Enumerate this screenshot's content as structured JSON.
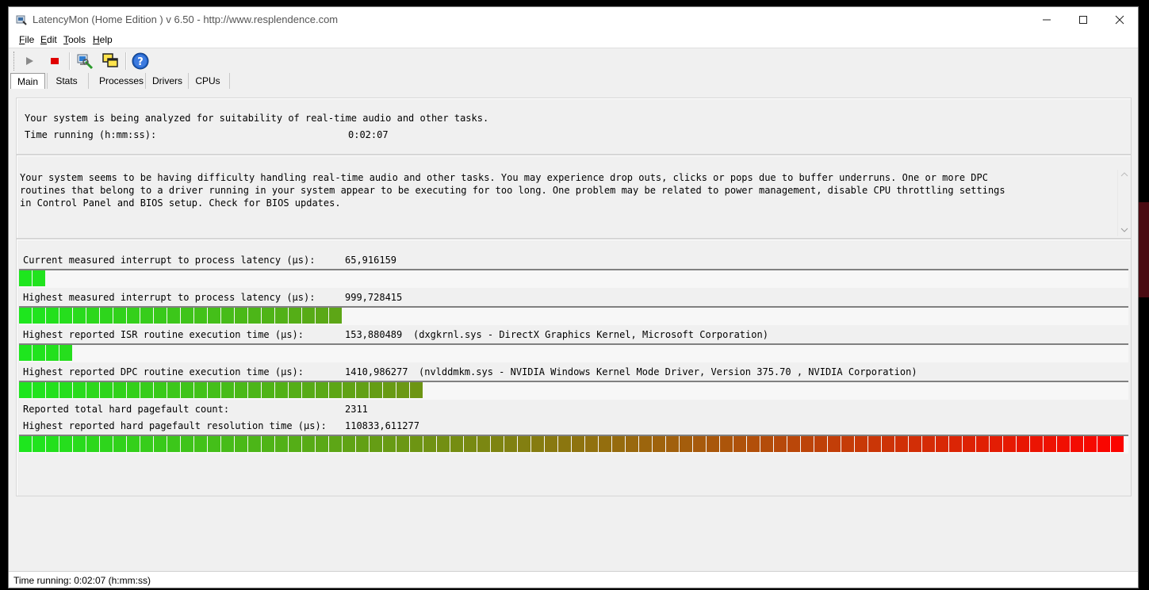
{
  "window": {
    "title": "LatencyMon  (Home Edition )  v 6.50 - http://www.resplendence.com",
    "controls": [
      "minimize-icon",
      "maximize-icon",
      "close-icon"
    ]
  },
  "menu": [
    {
      "accel": "F",
      "rest": "ile"
    },
    {
      "accel": "E",
      "rest": "dit"
    },
    {
      "accel": "T",
      "rest": "ools"
    },
    {
      "accel": "H",
      "rest": "elp"
    }
  ],
  "toolbar_icons": [
    "play-icon",
    "stop-icon",
    "analyze-icon",
    "windows-icon",
    "help-icon"
  ],
  "tabs": [
    {
      "label": "Main",
      "active": true
    },
    {
      "label": "Stats",
      "active": false
    },
    {
      "label": "Processes",
      "active": false
    },
    {
      "label": "Drivers",
      "active": false
    },
    {
      "label": "CPUs",
      "active": false
    }
  ],
  "status_panel": {
    "line1": "Your system is being analyzed for suitability of real-time audio and other tasks.",
    "time_label": "Time running (h:mm:ss):",
    "time_value": "0:02:07"
  },
  "conclusion": {
    "lines": [
      "Your system seems to be having difficulty handling real-time audio and other tasks. You may experience drop outs, clicks or pops due to buffer underruns. One or more DPC",
      "routines that belong to a driver running in your system appear to be executing for too long. One problem may be related to power management, disable CPU throttling settings",
      "in Control Panel and BIOS setup. Check for BIOS updates."
    ]
  },
  "measurements": [
    {
      "label": "Current measured interrupt to process latency (µs):",
      "value": "65,916159",
      "detail": "",
      "level": 0.023
    },
    {
      "label": "Highest measured interrupt to process latency (µs):",
      "value": "999,728415",
      "detail": "",
      "level": 0.29
    },
    {
      "label": "Highest reported ISR routine execution time (µs):",
      "value": "153,880489",
      "detail": "(dxgkrnl.sys - DirectX Graphics Kernel, Microsoft Corporation)",
      "level": 0.047
    },
    {
      "label": "Highest reported DPC routine execution time (µs):",
      "value": "1410,986277",
      "detail": "(nvlddmkm.sys - NVIDIA Windows Kernel Mode Driver, Version 375.70 , NVIDIA Corporation)",
      "level": 0.363
    },
    {
      "label": "Reported total hard pagefault count:",
      "value": "2311",
      "detail": ""
    },
    {
      "label": "Highest reported hard pagefault resolution time (µs):",
      "value": "110833,611277",
      "detail": "",
      "level": 1.0
    }
  ],
  "statusbar": {
    "text": "Time running: 0:02:07  (h:mm:ss)"
  },
  "colors": {
    "start": "#1ee61e",
    "end": "#ff0000",
    "border": "#808080"
  }
}
